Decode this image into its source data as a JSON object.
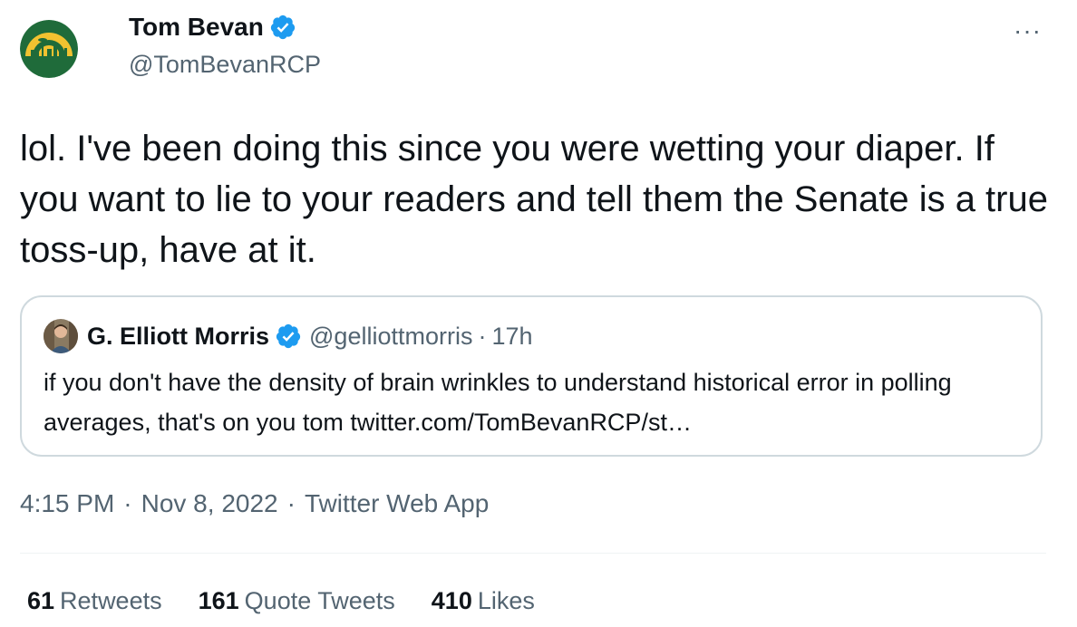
{
  "author": {
    "display_name": "Tom Bevan",
    "handle": "@TomBevanRCP",
    "verified_icon": "verified-badge-icon",
    "avatar_icon": "team-logo-icon"
  },
  "more_label": "···",
  "tweet": {
    "text": "lol. I've been doing this since you were wetting your diaper. If you want to lie to your readers and tell them the Senate is a true toss-up, have at it."
  },
  "quote": {
    "display_name": "G. Elliott Morris",
    "handle": "@gelliottmorris",
    "separator": "·",
    "time": "17h",
    "text": "if you don't have the density of brain wrinkles to understand historical error in polling averages, that's on you tom twitter.com/TomBevanRCP/st…"
  },
  "meta": {
    "time": "4:15 PM",
    "sep1": "·",
    "date": "Nov 8, 2022",
    "sep2": "·",
    "source": "Twitter Web App"
  },
  "stats": {
    "retweets_count": "61",
    "retweets_label": "Retweets",
    "quotes_count": "161",
    "quotes_label": "Quote Tweets",
    "likes_count": "410",
    "likes_label": "Likes"
  },
  "colors": {
    "verified": "#1d9bf0",
    "secondary_text": "#536471",
    "logo_green": "#1f6b3a",
    "logo_yellow": "#f2c230"
  }
}
